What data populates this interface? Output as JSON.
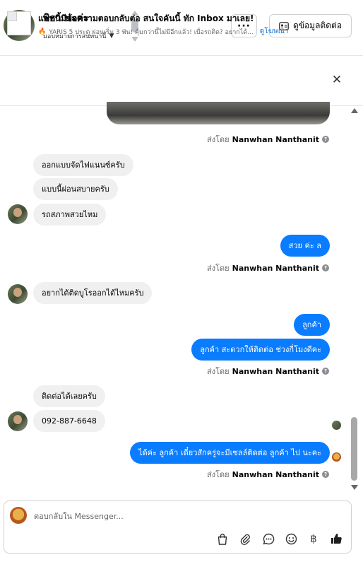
{
  "header": {
    "contact_name": "พิธา น่ะค่ะ",
    "assignee": "มอบหมายการสนทนานี้",
    "more_label": "···",
    "contact_info_label": "ดูข้อมูลติดต่อ"
  },
  "ad_banner": {
    "title": "แชทนี้มีข้อความตอบกลับต่อ สนใจคันนี้ ทัก Inbox มาเลย!",
    "body": "YARIS 5 ประตู ผ่อนเริ่ม 3 พัน! คุ้มกว่านี้ไม่มีอีกแล้ว! เบื่อรถติด? อยากได้...",
    "link": "ดูโฆษณา",
    "close": "✕"
  },
  "messages": {
    "sent_by_prefix": "ส่งโดย",
    "agent_name": "Nanwhan Nanthanit",
    "in_1": "ออกแบบจัดไฟแนนซ์ครับ",
    "in_2": "แบบนี้ผ่อนสบายครับ",
    "in_3": "รถสภาพสวยไหม",
    "out_1": "สวย ค่ะ  ล",
    "in_4": "อยากได้ติดบูโรออกได้ไหมครับ",
    "out_2": "ลูกค้า",
    "out_3": "ลูกค้า สะดวกให้ติดต่อ ช่วงกี่โมงดีคะ",
    "in_5": "ติดต่อได้เลยครับ",
    "in_6": "092-887-6648",
    "out_4": "ได้ค่ะ  ลูกค้า  เดี๋ยวสักครู่จะมีเซลล์ติดต่อ ลูกค้า ไป นะคะ"
  },
  "composer": {
    "placeholder": "ตอบกลับใน Messenger..."
  },
  "colors": {
    "accent": "#0a7cff",
    "incoming_bubble": "#f0f0f0",
    "link": "#1876d3"
  },
  "icons": [
    "more-icon",
    "contact-card-icon",
    "close-icon",
    "info-icon",
    "shopping-bag-icon",
    "paperclip-icon",
    "chat-bubble-icon",
    "emoji-icon",
    "baht-icon",
    "thumbs-up-icon"
  ]
}
